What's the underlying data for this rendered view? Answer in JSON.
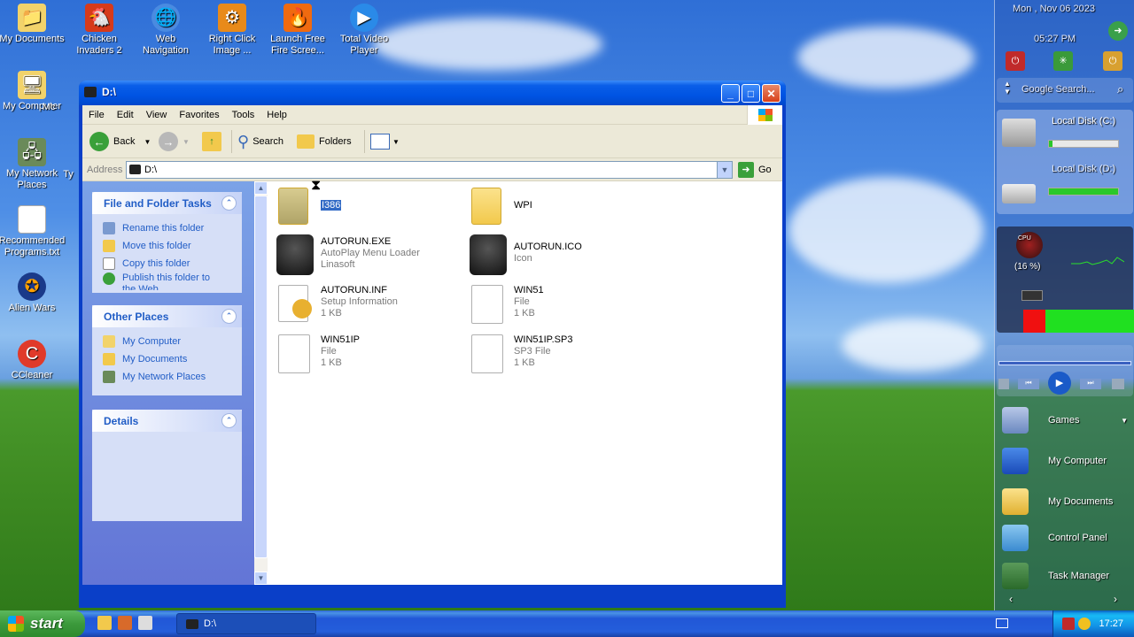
{
  "desktop": {
    "icons": [
      {
        "label": "My Documents"
      },
      {
        "label": "Chicken Invaders 2"
      },
      {
        "label": "Web Navigation"
      },
      {
        "label": "Right Click Image ..."
      },
      {
        "label": "Launch Free Fire Scree..."
      },
      {
        "label": "Total Video Player"
      },
      {
        "label": "My Computer"
      },
      {
        "label": "My Network Places"
      },
      {
        "label": "Recommended Programs.txt"
      },
      {
        "label": "Alien Wars"
      },
      {
        "label": "CCleaner"
      }
    ],
    "partial_labels": [
      "Mc",
      "Ty"
    ]
  },
  "sidebar": {
    "date": "Mon , Nov 06 2023",
    "time": "05:27 PM",
    "search_placeholder": "Google Search...",
    "disk_c": {
      "label": "Local Disk (C:)",
      "used_fraction": 0.05
    },
    "disk_d": {
      "label": "Local Disk (D:)",
      "used_fraction": 1.0
    },
    "cpu_label": "CPU",
    "cpu_percent": "(16 %)",
    "ram_fraction": 0.2,
    "links": [
      {
        "label": "Games"
      },
      {
        "label": "My Computer"
      },
      {
        "label": "My Documents"
      },
      {
        "label": "Control Panel"
      },
      {
        "label": "Task Manager"
      }
    ]
  },
  "window": {
    "title": "D:\\",
    "menu": [
      "File",
      "Edit",
      "View",
      "Favorites",
      "Tools",
      "Help"
    ],
    "toolbar": {
      "back": "Back",
      "search": "Search",
      "folders": "Folders"
    },
    "address": {
      "label": "Address",
      "value": "D:\\",
      "go": "Go"
    },
    "tasks": {
      "file_folder": {
        "title": "File and Folder Tasks",
        "items": [
          "Rename this folder",
          "Move this folder",
          "Copy this folder",
          "Publish this folder to the Web"
        ]
      },
      "other_places": {
        "title": "Other Places",
        "items": [
          "My Computer",
          "My Documents",
          "My Network Places"
        ]
      },
      "details": {
        "title": "Details"
      }
    },
    "files": [
      {
        "name": "I386",
        "type": "",
        "size": "",
        "selected": true
      },
      {
        "name": "WPI",
        "type": "",
        "size": ""
      },
      {
        "name": "AUTORUN.EXE",
        "type": "AutoPlay Menu Loader",
        "size": "Linasoft"
      },
      {
        "name": "AUTORUN.ICO",
        "type": "Icon",
        "size": ""
      },
      {
        "name": "AUTORUN.INF",
        "type": "Setup Information",
        "size": "1 KB"
      },
      {
        "name": "WIN51",
        "type": "File",
        "size": "1 KB"
      },
      {
        "name": "WIN51IP",
        "type": "File",
        "size": "1 KB"
      },
      {
        "name": "WIN51IP.SP3",
        "type": "SP3 File",
        "size": "1 KB"
      }
    ]
  },
  "taskbar": {
    "start": "start",
    "task": "D:\\",
    "clock": "17:27"
  }
}
